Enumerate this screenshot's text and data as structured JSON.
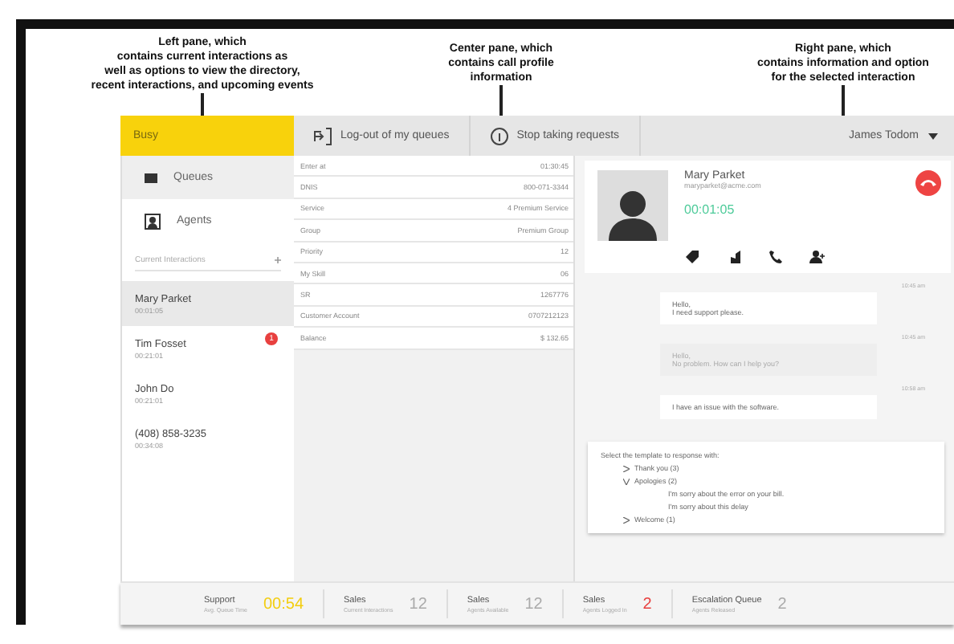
{
  "annotations": [
    {
      "lines": [
        "Left pane, which",
        "contains current interactions as",
        "well as options to view the directory,",
        "recent interactions, and upcoming events"
      ]
    },
    {
      "lines": [
        "Center pane, which",
        "contains call profile",
        "information"
      ]
    },
    {
      "lines": [
        "Right pane, which",
        "contains information and option",
        "for the selected interaction"
      ]
    }
  ],
  "topbar": {
    "status": "Busy",
    "actions": [
      {
        "label": "Log-out of my queues",
        "kind": "logout"
      },
      {
        "label": "Stop taking requests",
        "kind": "info"
      }
    ],
    "user": "James Todom"
  },
  "left_pane": {
    "nav": [
      {
        "label": "Queues",
        "selected": true,
        "kind": "queue"
      },
      {
        "label": "Agents",
        "selected": false,
        "kind": "agent"
      }
    ],
    "section": "Current Interactions",
    "interactions": [
      {
        "name": "Mary Parket",
        "time": "00:01:05",
        "selected": true
      },
      {
        "name": "Tim Fosset",
        "time": "00:21:01",
        "selected": false,
        "badge": "1"
      },
      {
        "name": "John Do",
        "time": "00:21:01",
        "selected": false
      },
      {
        "name": "(408) 858-3235",
        "time": "00:34:08",
        "selected": false
      }
    ]
  },
  "center_pane": {
    "fields": [
      {
        "label": "Enter at",
        "value": "01:30:45"
      },
      {
        "label": "DNIS",
        "value": "800-071-3344"
      },
      {
        "label": "Service",
        "value": "4 Premium Service"
      },
      {
        "label": "Group",
        "value": "Premium Group"
      },
      {
        "label": "Priority",
        "value": "12"
      },
      {
        "label": "My Skill",
        "value": "06"
      },
      {
        "label": "SR",
        "value": "1267776"
      },
      {
        "label": "Customer Account",
        "value": "0707212123"
      },
      {
        "label": "Balance",
        "value": "$ 132.65"
      }
    ]
  },
  "right_pane": {
    "contact": {
      "name": "Mary Parket",
      "email": "maryparket@acme.com",
      "timer": "00:01:05"
    },
    "messages": [
      {
        "time": "10:45 am",
        "text": "Hello,\nI need support please.",
        "from_agent": false
      },
      {
        "time": "10:45 am",
        "text": "Hello,\nNo problem. How can I help you?",
        "from_agent": true
      },
      {
        "time": "10:58 am",
        "text": "I have an issue with the software.",
        "from_agent": false
      }
    ],
    "templates": {
      "heading": "Select the template to response with:",
      "items": [
        {
          "label": "Thank you (3)",
          "expanded": false
        },
        {
          "label": "Apologies (2)",
          "expanded": true,
          "children": [
            {
              "label": "I'm sorry about the error on your bill."
            },
            {
              "label": "I'm sorry about this delay"
            }
          ]
        },
        {
          "label": "Welcome (1)",
          "expanded": false
        }
      ]
    }
  },
  "status_bar": [
    {
      "title": "Support",
      "subtitle": "Avg. Queue Time",
      "value": "00:54",
      "color": "#f3cd0f"
    },
    {
      "title": "Sales",
      "subtitle": "Current Interactions",
      "value": "12",
      "color": "#aaaaaa"
    },
    {
      "title": "Sales",
      "subtitle": "Agents Available",
      "value": "12",
      "color": "#aaaaaa"
    },
    {
      "title": "Sales",
      "subtitle": "Agents Logged In",
      "value": "2",
      "color": "#e8403f"
    },
    {
      "title": "Escalation Queue",
      "subtitle": "Agents Released",
      "value": "2",
      "color": "#aaaaaa"
    }
  ]
}
